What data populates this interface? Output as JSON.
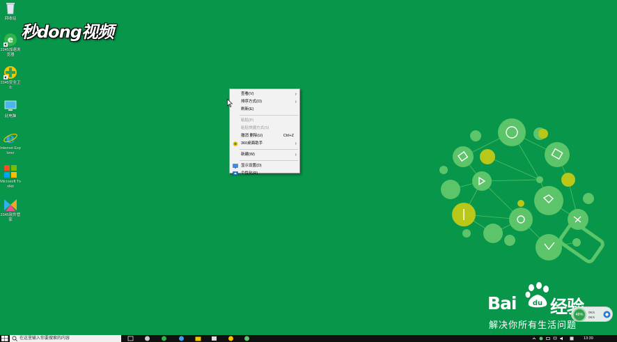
{
  "desktop": {
    "icons": [
      {
        "label": "回收站",
        "icon": "recycle-bin-icon"
      },
      {
        "label": "2345加速浏览器",
        "icon": "browser-e-icon"
      },
      {
        "label": "2345安全卫士",
        "icon": "security-guard-icon"
      },
      {
        "label": "此电脑",
        "icon": "this-pc-icon"
      },
      {
        "label": "Internet Explorer",
        "icon": "ie-icon"
      },
      {
        "label": "Microsoft Toolkit",
        "icon": "ms-toolkit-icon"
      },
      {
        "label": "2345软件管家",
        "icon": "software-manager-icon"
      }
    ]
  },
  "watermark": {
    "brand": "秒dong视频",
    "baidu_word": "Bai",
    "baidu_du": "du",
    "baidu_jingyan": "经验",
    "baidu_slogan": "解决你所有生活问题"
  },
  "context_menu": {
    "items": [
      {
        "label": "查看(V)",
        "submenu": true
      },
      {
        "label": "排序方式(O)",
        "submenu": true
      },
      {
        "label": "刷新(E)"
      },
      {
        "separator": true
      },
      {
        "label": "粘贴(P)",
        "disabled": true
      },
      {
        "label": "粘贴快捷方式(S)",
        "disabled": true
      },
      {
        "label": "撤消 删除(U)",
        "shortcut": "Ctrl+Z"
      },
      {
        "label": "360桌面助手",
        "submenu": true,
        "icon": "360-icon"
      },
      {
        "separator": true
      },
      {
        "label": "新建(W)",
        "submenu": true
      },
      {
        "separator": true
      },
      {
        "label": "显示设置(D)",
        "icon": "display-settings-icon"
      },
      {
        "label": "个性化(R)",
        "icon": "personalize-icon"
      }
    ]
  },
  "network_widget": {
    "percent": "48%",
    "up": "0K/s",
    "down": "0K/s"
  },
  "taskbar": {
    "search_placeholder": "在这里输入你要搜索的内容",
    "clock": "13:39"
  },
  "colors": {
    "desktop_bg": "#07964a",
    "bulb_light": "#5cc56a",
    "bulb_yellow": "#b9c719"
  }
}
